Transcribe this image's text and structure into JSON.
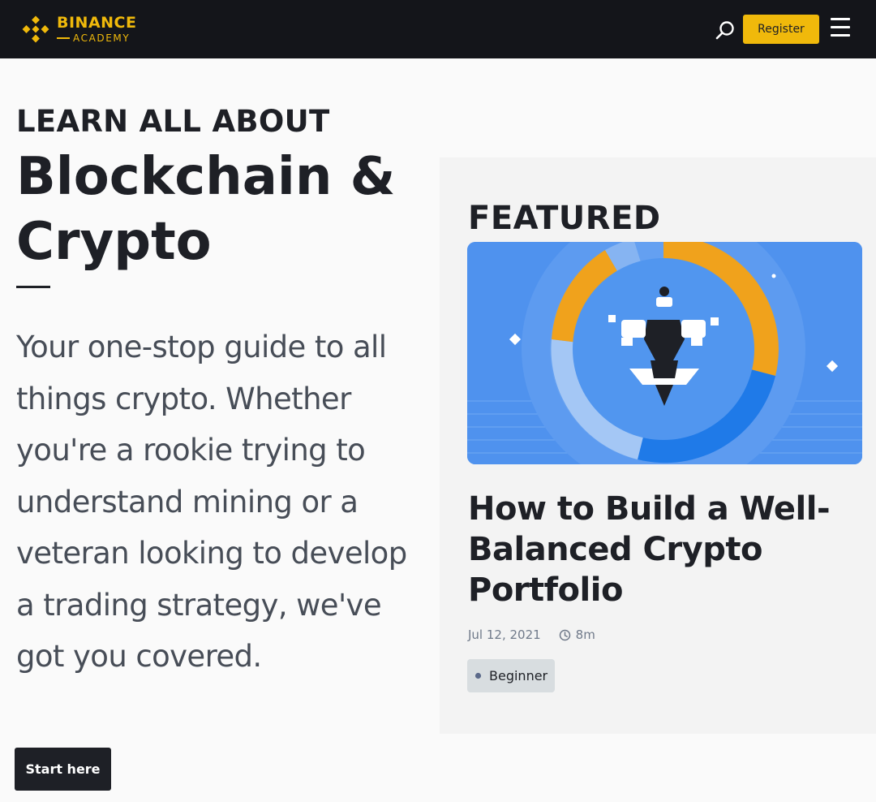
{
  "header": {
    "brand_name": "BINANCE",
    "brand_sub": "ACADEMY",
    "search_icon": "search-icon",
    "register_label": "Register",
    "menu_icon": "hamburger-menu-icon",
    "brand_color": "#f0b90b",
    "background_color": "#14151a"
  },
  "hero": {
    "kicker": "LEARN ALL ABOUT",
    "title": "Blockchain & Crypto",
    "description": "Your one-stop guide to all things crypto. Whether you're a rookie trying to understand mining or a veteran looking to develop a trading strategy, we've got you covered.",
    "cta_label": "Start here"
  },
  "featured": {
    "section_label": "FEATURED",
    "article": {
      "title": "How to Build a Well-Balanced Crypto Portfolio",
      "date": "Jul 12, 2021",
      "read_time": "8m",
      "level": "Beginner",
      "clock_icon": "clock-icon",
      "image_icon": "meditating-figure-donut-chart-illustration"
    }
  }
}
